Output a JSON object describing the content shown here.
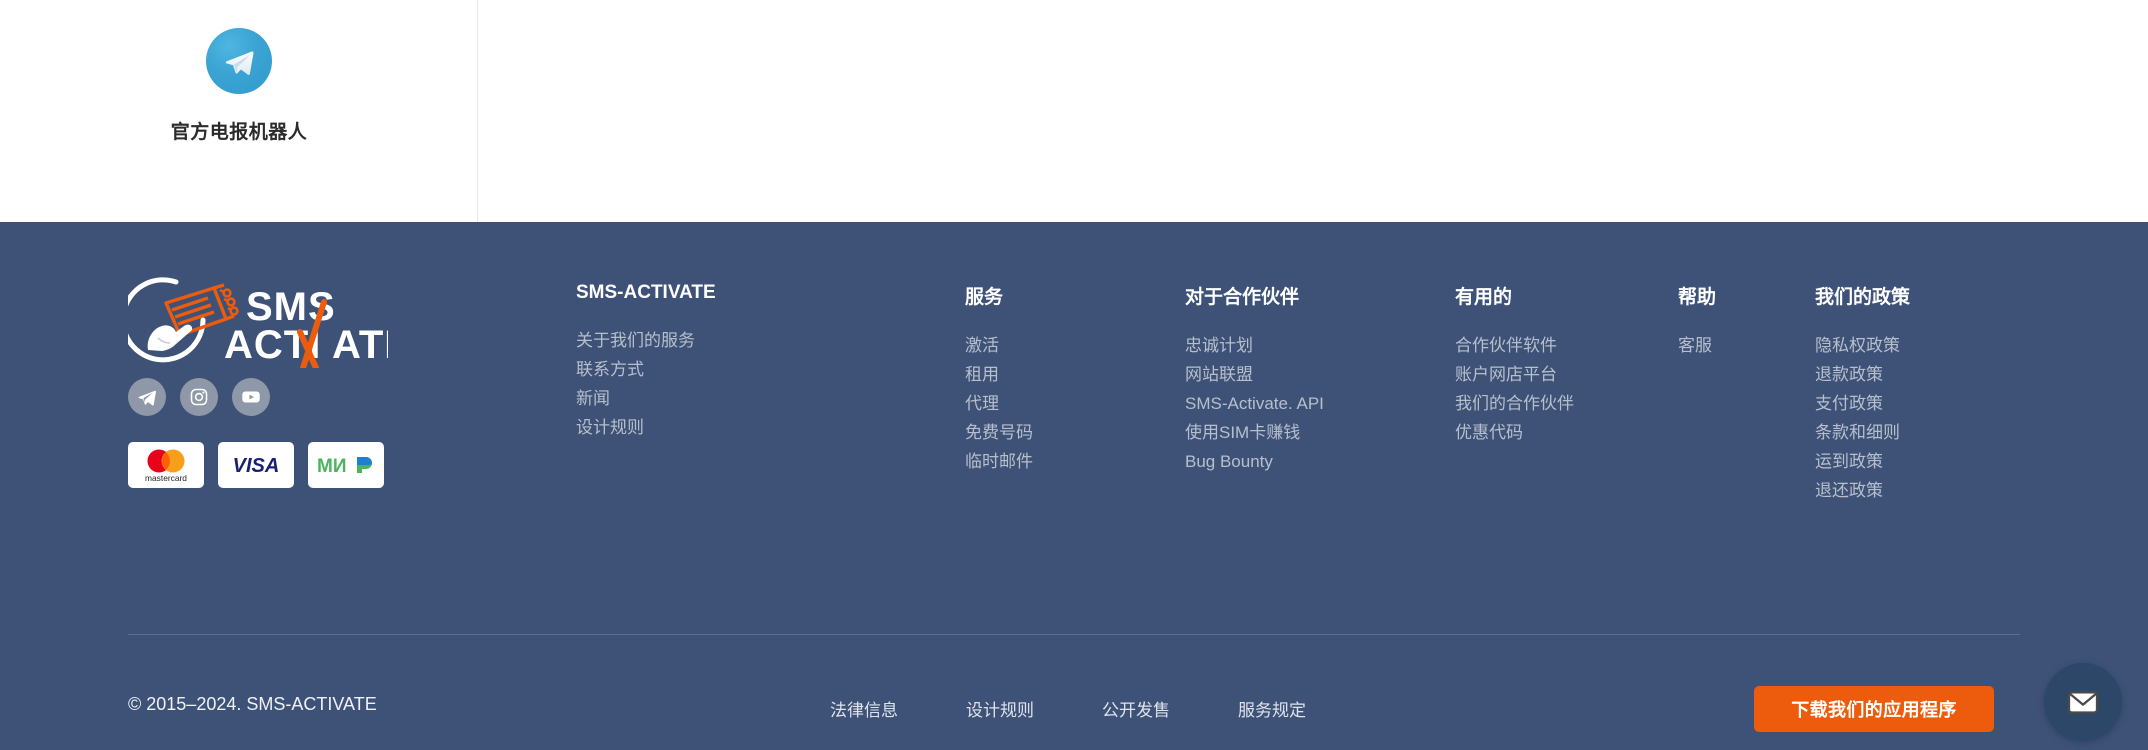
{
  "top": {
    "telegram_promo": {
      "icon": "telegram-icon",
      "label": "官方电报机器人"
    }
  },
  "footer": {
    "brand": {
      "logo_text_top": "SMS",
      "logo_text_bottom": "ACTIVATE",
      "accent_color": "#ec5c0c",
      "background_color": "#3e5278"
    },
    "socials": [
      {
        "name": "telegram",
        "icon": "telegram-icon"
      },
      {
        "name": "instagram",
        "icon": "instagram-icon"
      },
      {
        "name": "youtube",
        "icon": "youtube-icon"
      }
    ],
    "payments": [
      {
        "name": "mastercard",
        "label": "mastercard"
      },
      {
        "name": "visa",
        "label": "VISA"
      },
      {
        "name": "mir",
        "label": "МИР"
      }
    ],
    "columns": [
      {
        "title": "SMS-ACTIVATE",
        "links": [
          "关于我们的服务",
          "联系方式",
          "新闻",
          "设计规则"
        ]
      },
      {
        "title": "服务",
        "links": [
          "激活",
          "租用",
          "代理",
          "免费号码",
          "临时邮件"
        ]
      },
      {
        "title": "对于合作伙伴",
        "links": [
          "忠诚计划",
          "网站联盟",
          "SMS-Activate. API",
          "使用SIM卡赚钱",
          "Bug Bounty"
        ]
      },
      {
        "title": "有用的",
        "links": [
          "合作伙伴软件",
          "账户网店平台",
          "我们的合作伙伴",
          "优惠代码"
        ]
      },
      {
        "title": "帮助",
        "links": [
          "客服"
        ]
      },
      {
        "title": "我们的政策",
        "links": [
          "隐私权政策",
          "退款政策",
          "支付政策",
          "条款和细则",
          "运到政策",
          "退还政策"
        ]
      }
    ],
    "bottom": {
      "copyright": "© 2015–2024. SMS-ACTIVATE",
      "links": [
        "法律信息",
        "设计规则",
        "公开发售",
        "服务规定"
      ],
      "download_button": "下载我们的应用程序"
    }
  },
  "floating": {
    "chat_button": {
      "icon": "envelope-icon"
    }
  }
}
